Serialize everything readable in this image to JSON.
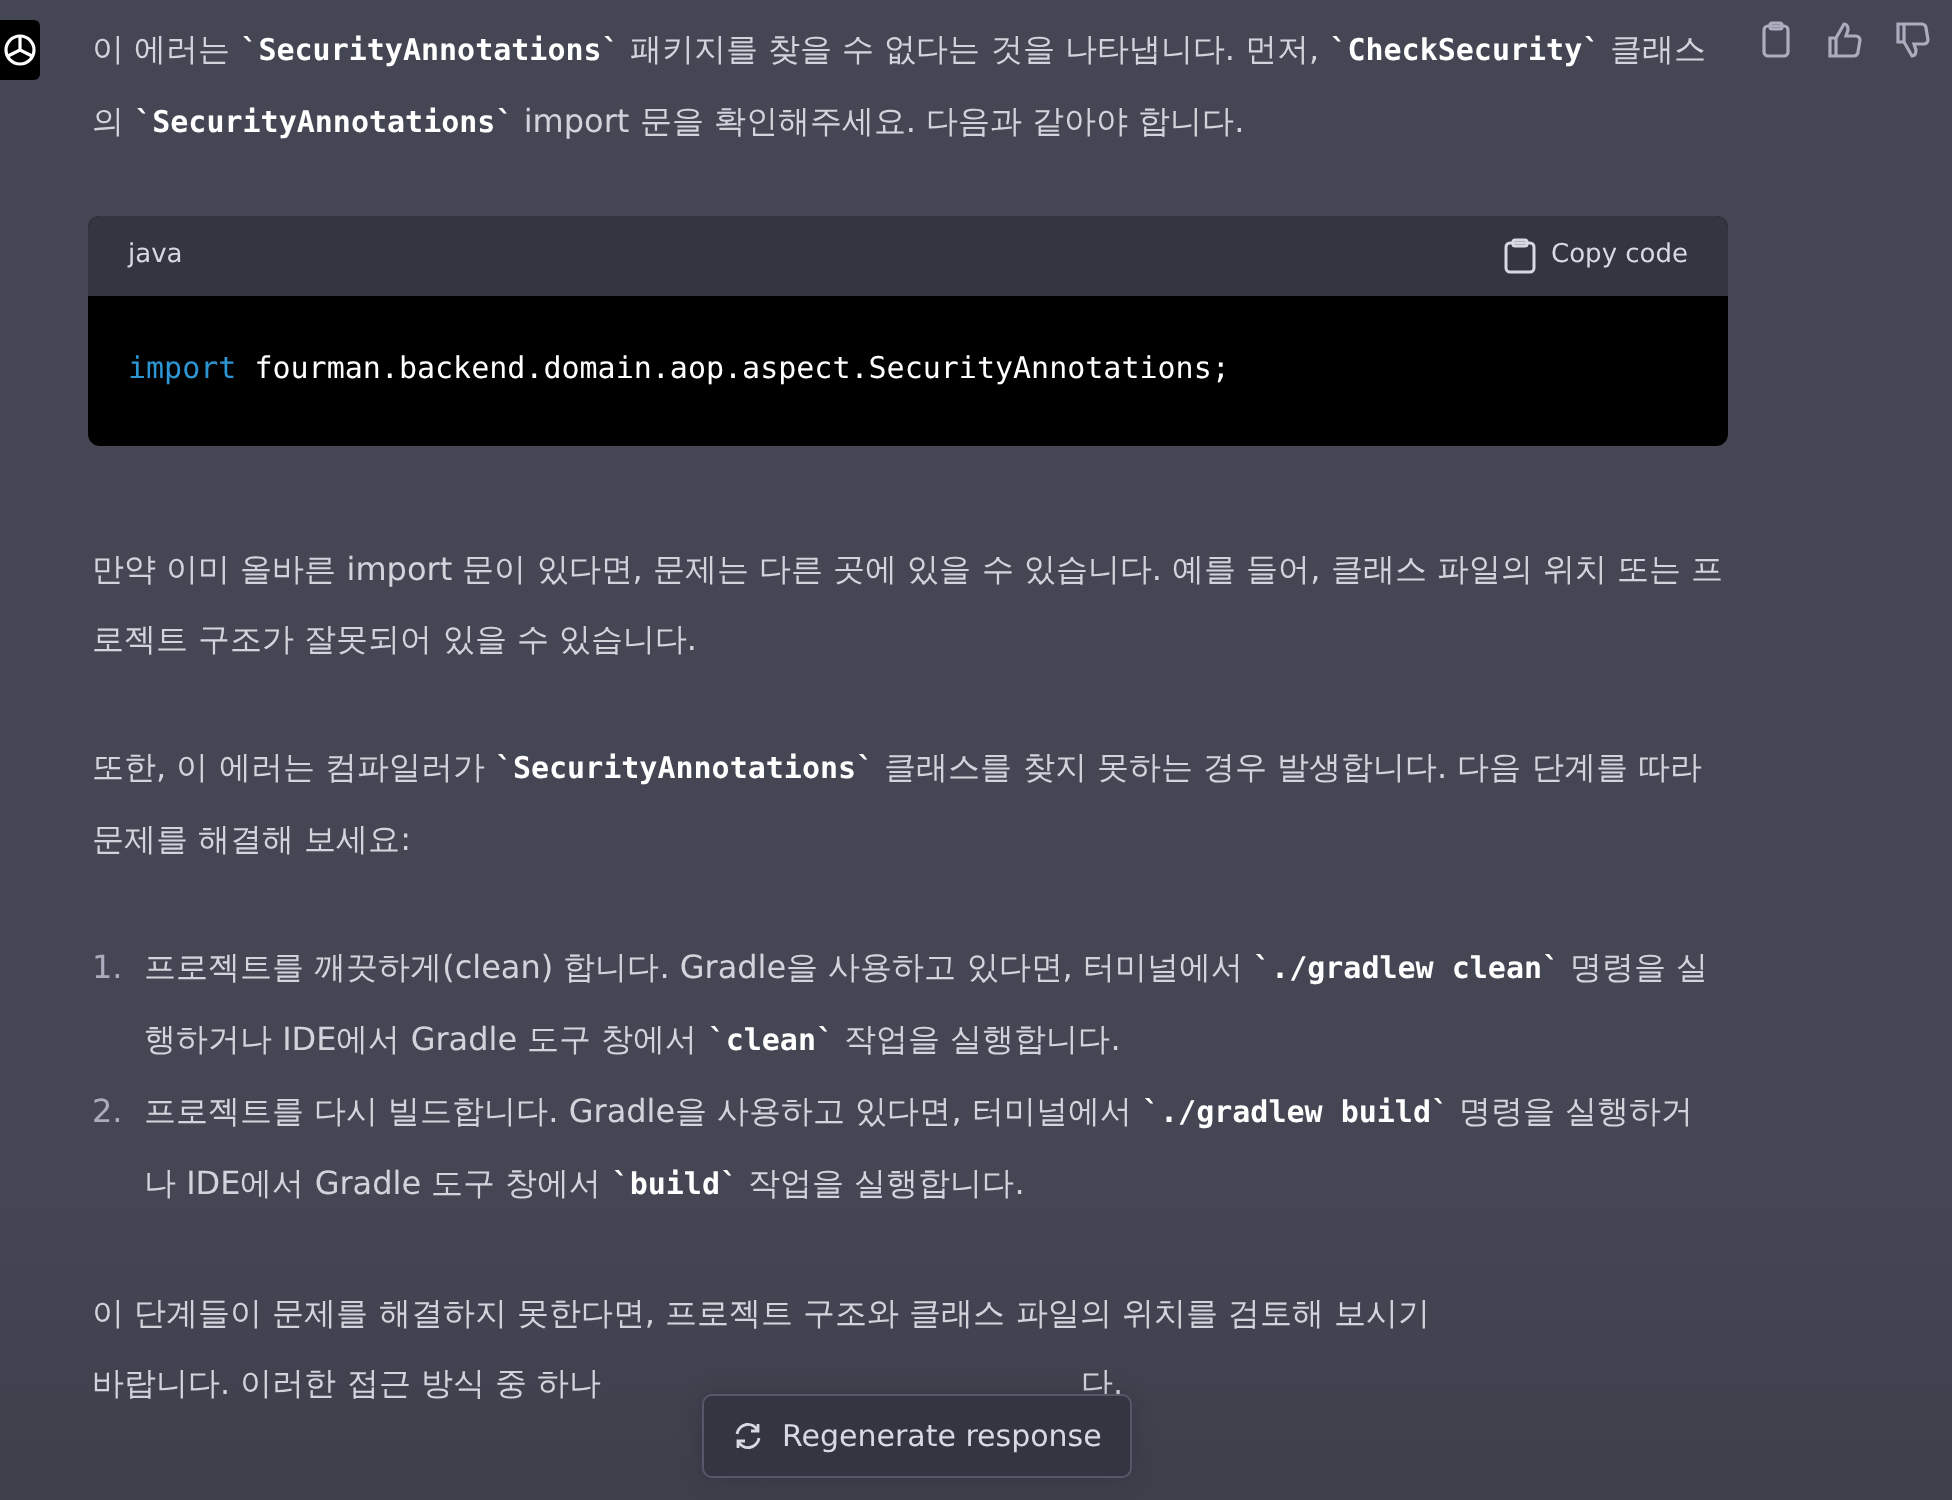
{
  "message": {
    "paragraphs_top": [
      {
        "text": "이 에러는 **`SecurityAnnotations`** 패키지를 찾을 수 없다는 것을 나타냅니다. 먼저, **`CheckSecurity`** 클래스의 **`SecurityAnnotations`** import 문을 확인해주세요. 다음과 같아야 합니다."
      }
    ],
    "code_block": {
      "language": "java",
      "copy_label": "Copy code",
      "keyword": "import",
      "code": "fourman.backend.domain.aop.aspect.SecurityAnnotations;"
    },
    "paragraphs": [
      {
        "text": "만약 이미 올바른 import 문이 있다면, 문제는 다른 곳에 있을 수 있습니다. 예를 들어, 클래스 파일의 위치 또는 프로젝트 구조가 잘못되어 있을 수 있습니다."
      },
      {
        "text": "또한, 이 에러는 컴파일러가 **`SecurityAnnotations`** 클래스를 찾지 못하는 경우 발생합니다. 다음 단계를 따라 문제를 해결해 보세요:"
      }
    ],
    "steps": [
      {
        "number": "1.",
        "text": "프로젝트를 깨끗하게(clean) 합니다. Gradle을 사용하고 있다면, 터미널에서 **`./gradlew clean`** 명령을 실행하거나 IDE에서 Gradle 도구 창에서 **`clean`** 작업을 실행합니다."
      },
      {
        "number": "2.",
        "text": "프로젝트를 다시 빌드합니다. Gradle을 사용하고 있다면, 터미널에서 **`./gradlew build`** 명령을 실행하거나 IDE에서 Gradle 도구 창에서 **`build`** 작업을 실행합니다."
      }
    ],
    "last_paragraph": {
      "line_1": "이 단계들이 문제를 해결하지 못한다면, 프로젝트 구조와 클래스 파일의 위치를 검토해 보시기",
      "line_2_before": "바랍니다. 이러한 접근 방식 중 하나",
      "line_2_after": "다."
    }
  },
  "regenerate_button": {
    "label": "Regenerate response"
  }
}
